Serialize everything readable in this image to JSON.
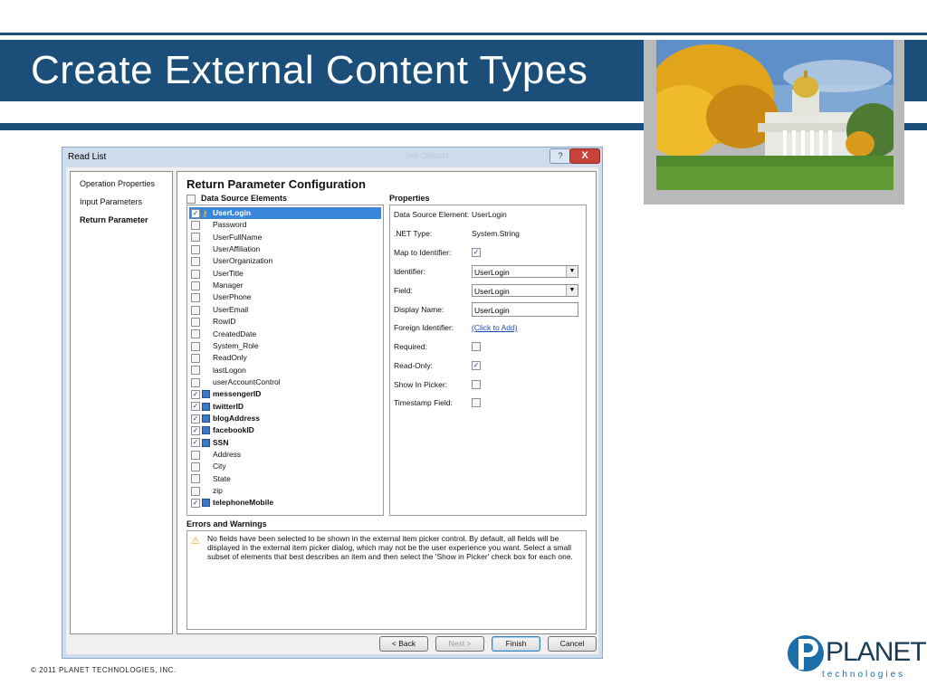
{
  "slide": {
    "title": "Create External Content Types",
    "footer": "© 2011 PLANET TECHNOLOGIES, INC.",
    "logo_word": "PLANET",
    "logo_sub": "technologies",
    "colors": {
      "band": "#1b4f7a",
      "selection": "#3a86d8"
    }
  },
  "dialog": {
    "title": "Read List",
    "ghost_tab": "Site Objects",
    "help_label": "?",
    "close_label": "X",
    "nav": [
      "Operation Properties",
      "Input Parameters",
      "Return Parameter"
    ],
    "section_title": "Return Parameter Configuration",
    "list_header": "Data Source Elements",
    "elements": [
      {
        "label": "UserLogin",
        "checked": true,
        "icon": "key-icon",
        "bold": true,
        "selected": true
      },
      {
        "label": "Password",
        "checked": false
      },
      {
        "label": "UserFullName",
        "checked": false
      },
      {
        "label": "UserAffiliation",
        "checked": false
      },
      {
        "label": "UserOrganization",
        "checked": false
      },
      {
        "label": "UserTitle",
        "checked": false
      },
      {
        "label": "Manager",
        "checked": false
      },
      {
        "label": "UserPhone",
        "checked": false
      },
      {
        "label": "UserEmail",
        "checked": false
      },
      {
        "label": "RowID",
        "checked": false
      },
      {
        "label": "CreatedDate",
        "checked": false
      },
      {
        "label": "System_Role",
        "checked": false
      },
      {
        "label": "ReadOnly",
        "checked": false
      },
      {
        "label": "lastLogon",
        "checked": false
      },
      {
        "label": "userAccountControl",
        "checked": false
      },
      {
        "label": "messengerID",
        "checked": true,
        "icon": "table-icon",
        "bold": true
      },
      {
        "label": "twitterID",
        "checked": true,
        "icon": "table-icon",
        "bold": true
      },
      {
        "label": "blogAddress",
        "checked": true,
        "icon": "table-icon",
        "bold": true
      },
      {
        "label": "facebookID",
        "checked": true,
        "icon": "table-icon",
        "bold": true
      },
      {
        "label": "SSN",
        "checked": true,
        "icon": "table-icon",
        "bold": true
      },
      {
        "label": "Address",
        "checked": false
      },
      {
        "label": "City",
        "checked": false
      },
      {
        "label": "State",
        "checked": false
      },
      {
        "label": "zip",
        "checked": false
      },
      {
        "label": "telephoneMobile",
        "checked": true,
        "icon": "table-icon",
        "bold": true
      }
    ],
    "properties_header": "Properties",
    "properties": {
      "data_source_element_label": "Data Source Element:",
      "data_source_element_value": "UserLogin",
      "net_type_label": ".NET Type:",
      "net_type_value": "System.String",
      "map_to_identifier_label": "Map to Identifier:",
      "map_to_identifier_checked": true,
      "identifier_label": "Identifier:",
      "identifier_value": "UserLogin",
      "field_label": "Field:",
      "field_value": "UserLogin",
      "display_name_label": "Display Name:",
      "display_name_value": "UserLogin",
      "foreign_identifier_label": "Foreign Identifier:",
      "foreign_identifier_link": "(Click to Add)",
      "required_label": "Required:",
      "required_checked": false,
      "read_only_label": "Read-Only:",
      "read_only_checked": true,
      "show_in_picker_label": "Show In Picker:",
      "show_in_picker_checked": false,
      "timestamp_field_label": "Timestamp Field:",
      "timestamp_field_checked": false
    },
    "errors_header": "Errors and Warnings",
    "warning_text": "No fields have been selected to be shown in the external item picker control. By default, all fields will be displayed in the external item picker dialog, which may not be the user experience you want. Select a small subset of elements that best describes an item and then select the 'Show in Picker' check box for each one.",
    "buttons": {
      "back": "< Back",
      "next": "Next >",
      "finish": "Finish",
      "cancel": "Cancel"
    }
  }
}
